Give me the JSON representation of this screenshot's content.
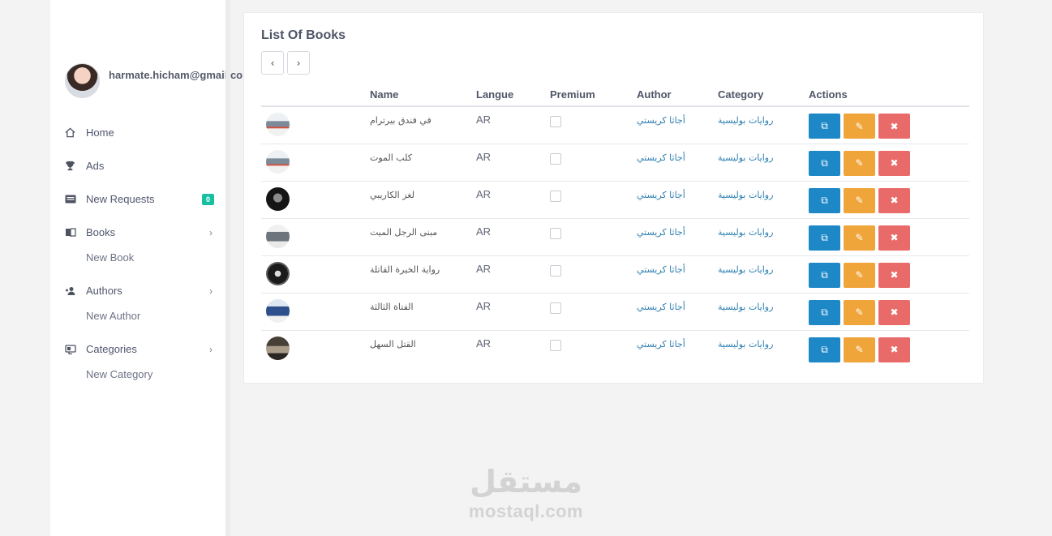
{
  "user": {
    "email": "harmate.hicham@gmail.com"
  },
  "sidebar": {
    "items": [
      {
        "label": "Home",
        "icon": "home-icon"
      },
      {
        "label": "Ads",
        "icon": "trophy-icon"
      },
      {
        "label": "New Requests",
        "icon": "news-icon",
        "badge": "0"
      },
      {
        "label": "Books",
        "icon": "book-icon",
        "submenu": "New Book"
      },
      {
        "label": "Authors",
        "icon": "users-icon",
        "submenu": "New Author"
      },
      {
        "label": "Categories",
        "icon": "tag-icon",
        "submenu": "New Category"
      }
    ]
  },
  "main": {
    "title": "List Of Books",
    "pager": {
      "prev": "‹",
      "next": "›"
    },
    "columns": [
      "Name",
      "Langue",
      "Premium",
      "Author",
      "Category",
      "Actions"
    ],
    "rows": [
      {
        "name": "في فندق بيرترام",
        "lang": "AR",
        "author": "أجاثا كريستي",
        "category": "روايات بوليسية"
      },
      {
        "name": "كلب الموت",
        "lang": "AR",
        "author": "أجاثا كريستي",
        "category": "روايات بوليسية"
      },
      {
        "name": "لغز الكاريبي",
        "lang": "AR",
        "author": "أجاثا كريستي",
        "category": "روايات بوليسية"
      },
      {
        "name": "مبنى الرجل الميت",
        "lang": "AR",
        "author": "أجاثا كريستي",
        "category": "روايات بوليسية"
      },
      {
        "name": "رواية الخيرة القاتلة",
        "lang": "AR",
        "author": "أجاثا كريستي",
        "category": "روايات بوليسية"
      },
      {
        "name": "الفتاة الثالثة",
        "lang": "AR",
        "author": "أجاثا كريستي",
        "category": "روايات بوليسية"
      },
      {
        "name": "القتل السهل",
        "lang": "AR",
        "author": "أجاثا كريستي",
        "category": "روايات بوليسية"
      }
    ],
    "actions": {
      "view": "⧉",
      "edit": "✎",
      "delete": "✖"
    }
  },
  "watermark": {
    "arabic": "مستقل",
    "latin": "mostaql.com"
  },
  "colors": {
    "view": "#1e88c7",
    "edit": "#f0a53a",
    "delete": "#e86b69",
    "badge": "#16c1a2",
    "link": "#2d7fb0"
  }
}
